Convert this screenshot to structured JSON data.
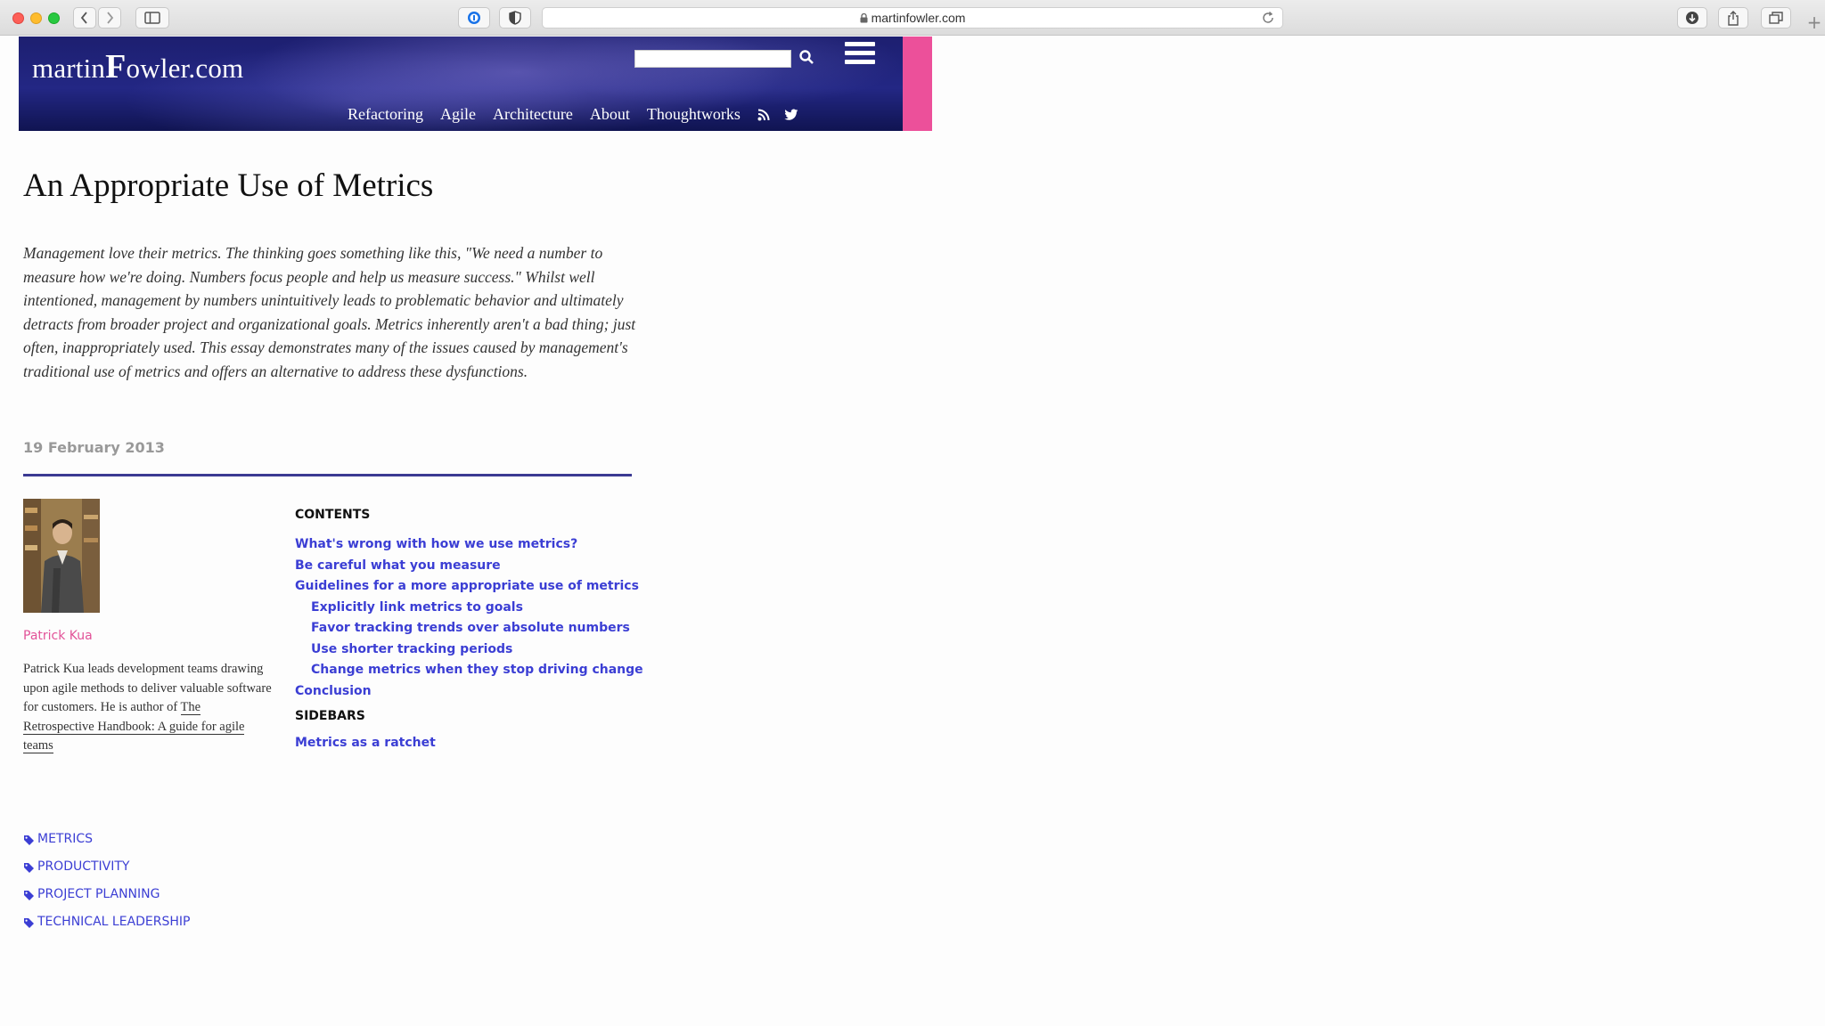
{
  "browser": {
    "url": "martinfowler.com"
  },
  "site": {
    "logo": {
      "part1": "martin",
      "part2": "F",
      "part3": "owler.com"
    },
    "search": {
      "value": "",
      "placeholder": ""
    },
    "nav": [
      "Refactoring",
      "Agile",
      "Architecture",
      "About",
      "Thoughtworks"
    ]
  },
  "article": {
    "title": "An Appropriate Use of Metrics",
    "abstract": "Management love their metrics. The thinking goes something like this, \"We need a number to measure how we're doing. Numbers focus people and help us measure success.\" Whilst well intentioned, management by numbers unintuitively leads to problematic behavior and ultimately detracts from broader project and organizational goals. Metrics inherently aren't a bad thing; just often, inappropriately used. This essay demonstrates many of the issues caused by management's traditional use of metrics and offers an alternative to address these dysfunctions.",
    "date": "19 February 2013"
  },
  "author": {
    "name": "Patrick Kua",
    "bio": "Patrick Kua leads development teams drawing upon agile methods to deliver valuable software for customers. He is author of",
    "book": "The Retrospective Handbook: A guide for agile teams"
  },
  "contents": {
    "heading": "CONTENTS",
    "items": [
      "What's wrong with how we use metrics?",
      "Be careful what you measure",
      "Guidelines for a more appropriate use of metrics",
      "Explicitly link metrics to goals",
      "Favor tracking trends over absolute numbers",
      "Use shorter tracking periods",
      "Change metrics when they stop driving change",
      "Conclusion"
    ]
  },
  "sidebars": {
    "heading": "SIDEBARS",
    "items": [
      "Metrics as a ratchet"
    ]
  },
  "tags": [
    "METRICS",
    "PRODUCTIVITY",
    "PROJECT PLANNING",
    "TECHNICAL LEADERSHIP"
  ],
  "colors": {
    "header": "#1d1f70",
    "accent_pink": "#ec509a",
    "link": "#3b3ed4",
    "rule": "#3b3a93"
  }
}
